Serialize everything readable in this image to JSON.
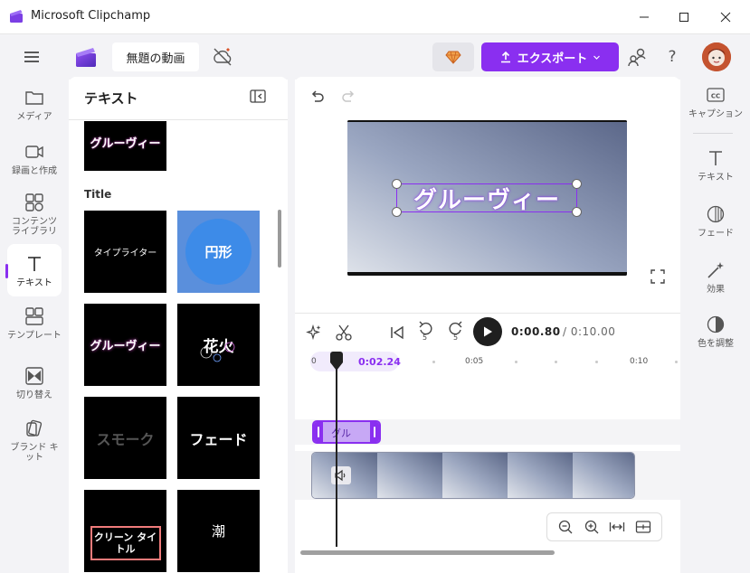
{
  "window": {
    "title": "Microsoft Clipchamp",
    "controls": [
      "minimize",
      "maximize",
      "close"
    ]
  },
  "header": {
    "project_name": "無題の動画",
    "export_label": "エクスポート",
    "help_label": "?"
  },
  "left_nav": {
    "items": [
      {
        "label": "メディア",
        "icon": "folder-icon"
      },
      {
        "label": "録画と作成",
        "icon": "camera-icon"
      },
      {
        "label": "コンテンツ ライブラリ",
        "icon": "library-icon"
      },
      {
        "label": "テキスト",
        "icon": "text-icon",
        "active": true
      },
      {
        "label": "テンプレート",
        "icon": "template-icon"
      },
      {
        "label": "切り替え",
        "icon": "transition-icon"
      },
      {
        "label": "ブランド キット",
        "icon": "brand-kit-icon"
      }
    ]
  },
  "text_panel": {
    "title": "テキスト",
    "section_title": "Title",
    "items": [
      {
        "label": "グルーヴィー"
      },
      {
        "label": "タイプライター"
      },
      {
        "label": "円形"
      },
      {
        "label": "グルーヴィー"
      },
      {
        "label": "花火"
      },
      {
        "label": "スモーク"
      },
      {
        "label": "フェード"
      },
      {
        "label": "クリーン タイトル"
      },
      {
        "label": "潮"
      }
    ]
  },
  "preview": {
    "overlay_text": "グルーヴィー"
  },
  "timeline": {
    "current_time": "0:00.80",
    "total_time": "/ 0:10.00",
    "skip_back_seconds": "5",
    "skip_forward_seconds": "5",
    "ruler": {
      "start": "0",
      "marker": "0:02.24",
      "ticks": [
        "0:05",
        "0:10"
      ]
    },
    "text_clip_label": "グル"
  },
  "right_tools": {
    "items": [
      {
        "label": "キャプション",
        "icon": "captions-icon"
      },
      {
        "label": "テキスト",
        "icon": "text-icon"
      },
      {
        "label": "フェード",
        "icon": "fade-icon"
      },
      {
        "label": "効果",
        "icon": "effects-icon"
      },
      {
        "label": "色を調整",
        "icon": "color-adjust-icon"
      }
    ]
  },
  "colors": {
    "accent": "#8a2ff0",
    "panel_bg": "#f3f3f6",
    "thumb_bg": "#000000",
    "circle_blue": "#3d8be8"
  }
}
